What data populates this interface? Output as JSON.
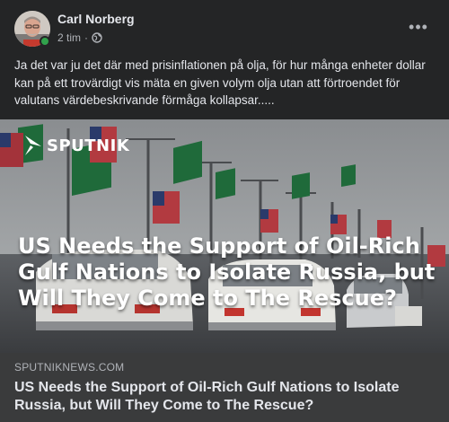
{
  "post": {
    "author": "Carl Norberg",
    "time": "2 tim",
    "separator": "·",
    "audience_icon": "globe-icon",
    "more_icon": "more-options-icon",
    "more_glyph": "•••",
    "text": "Ja det var ju det där med prisinflationen på olja, för hur många enheter dollar kan på ett trovärdigt vis mäta en given volym olja utan att förtroendet för valutans värdebeskrivande förmåga kollapsar....."
  },
  "link": {
    "brand": "SPUTNIK",
    "image_headline": "US Needs the Support of Oil-Rich Gulf Nations to Isolate Russia, but Will They Come to The Rescue?",
    "domain": "SPUTNIKNEWS.COM",
    "title": "US Needs the Support of Oil-Rich Gulf Nations to Isolate Russia, but Will They Come to The Rescue?"
  },
  "colors": {
    "card_bg": "#242526",
    "link_footer_bg": "#3a3b3c",
    "primary_text": "#e4e6eb",
    "secondary_text": "#b0b3b8",
    "online": "#31a24c"
  }
}
